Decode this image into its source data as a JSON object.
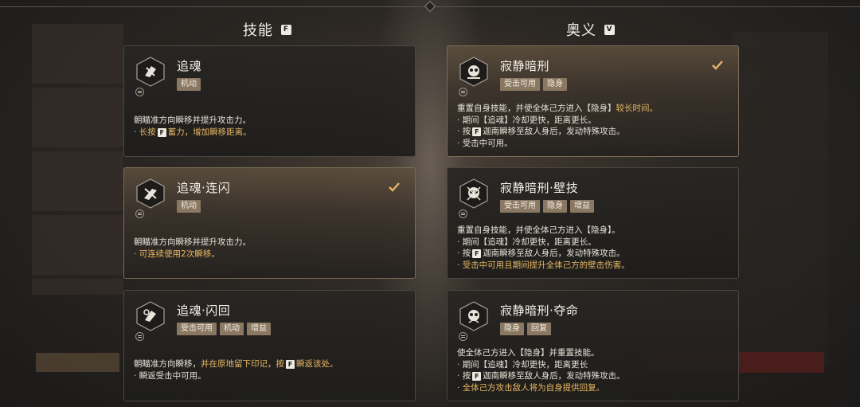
{
  "colors": {
    "accent_gold": "#e7b763",
    "tag_bg": "#8a7862",
    "card_bg": "#252320"
  },
  "headers": {
    "skills": {
      "label": "技能",
      "key": "F"
    },
    "ultimates": {
      "label": "奥义",
      "key": "V"
    }
  },
  "skills": [
    {
      "name": "追魂",
      "selected": false,
      "tags": [
        "机动"
      ],
      "desc": {
        "l1": "朝瞄准方向瞬移并提升攻击力。",
        "l2a": "长按",
        "l2key": "F",
        "l2b": "蓄力，增加瞬移距离。"
      }
    },
    {
      "name": "追魂·连闪",
      "selected": true,
      "tags": [
        "机动"
      ],
      "desc": {
        "l1": "朝瞄准方向瞬移并提升攻击力。",
        "l2": "可连续使用2次瞬移。"
      }
    },
    {
      "name": "追魂·闪回",
      "selected": false,
      "tags": [
        "受击可用",
        "机动",
        "增益"
      ],
      "desc": {
        "l1a": "朝瞄准方向瞬移，",
        "l1b": "并在原地留下印记，按",
        "l1key": "F",
        "l1c": "瞬返该处。",
        "l2": "瞬返受击中可用。"
      }
    }
  ],
  "ultimates": [
    {
      "name": "寂静暗刑",
      "selected": true,
      "tags": [
        "受击可用",
        "隐身"
      ],
      "desc": {
        "l1a": "重置自身技能，并使全体己方进入【隐身】",
        "l1b": "较长时间。",
        "l2": "期间【追魂】冷却更快，距离更长。",
        "l3a": "按",
        "l3key": "F",
        "l3b": "迦南瞬移至敌人身后，发动特殊攻击。",
        "l4": "受击中可用。"
      }
    },
    {
      "name": "寂静暗刑·壁技",
      "selected": false,
      "tags": [
        "受击可用",
        "隐身",
        "增益"
      ],
      "desc": {
        "l1": "重置自身技能，并使全体己方进入【隐身】。",
        "l2": "期间【追魂】冷却更快，距离更长。",
        "l3a": "按",
        "l3key": "F",
        "l3b": "迦南瞬移至敌人身后，发动特殊攻击。",
        "l4": "受击中可用且期间提升全体己方的壁击伤害。"
      }
    },
    {
      "name": "寂静暗刑·夺命",
      "selected": false,
      "tags": [
        "隐身",
        "回复"
      ],
      "desc": {
        "l1": "使全体己方进入【隐身】并重置技能。",
        "l2": "期间【追魂】冷却更快，距离更长",
        "l3a": "按",
        "l3key": "F",
        "l3b": "迦南瞬移至敌人身后，发动特殊攻击。",
        "l4": "全体己方攻击敌人将为自身提供回复。"
      }
    }
  ]
}
